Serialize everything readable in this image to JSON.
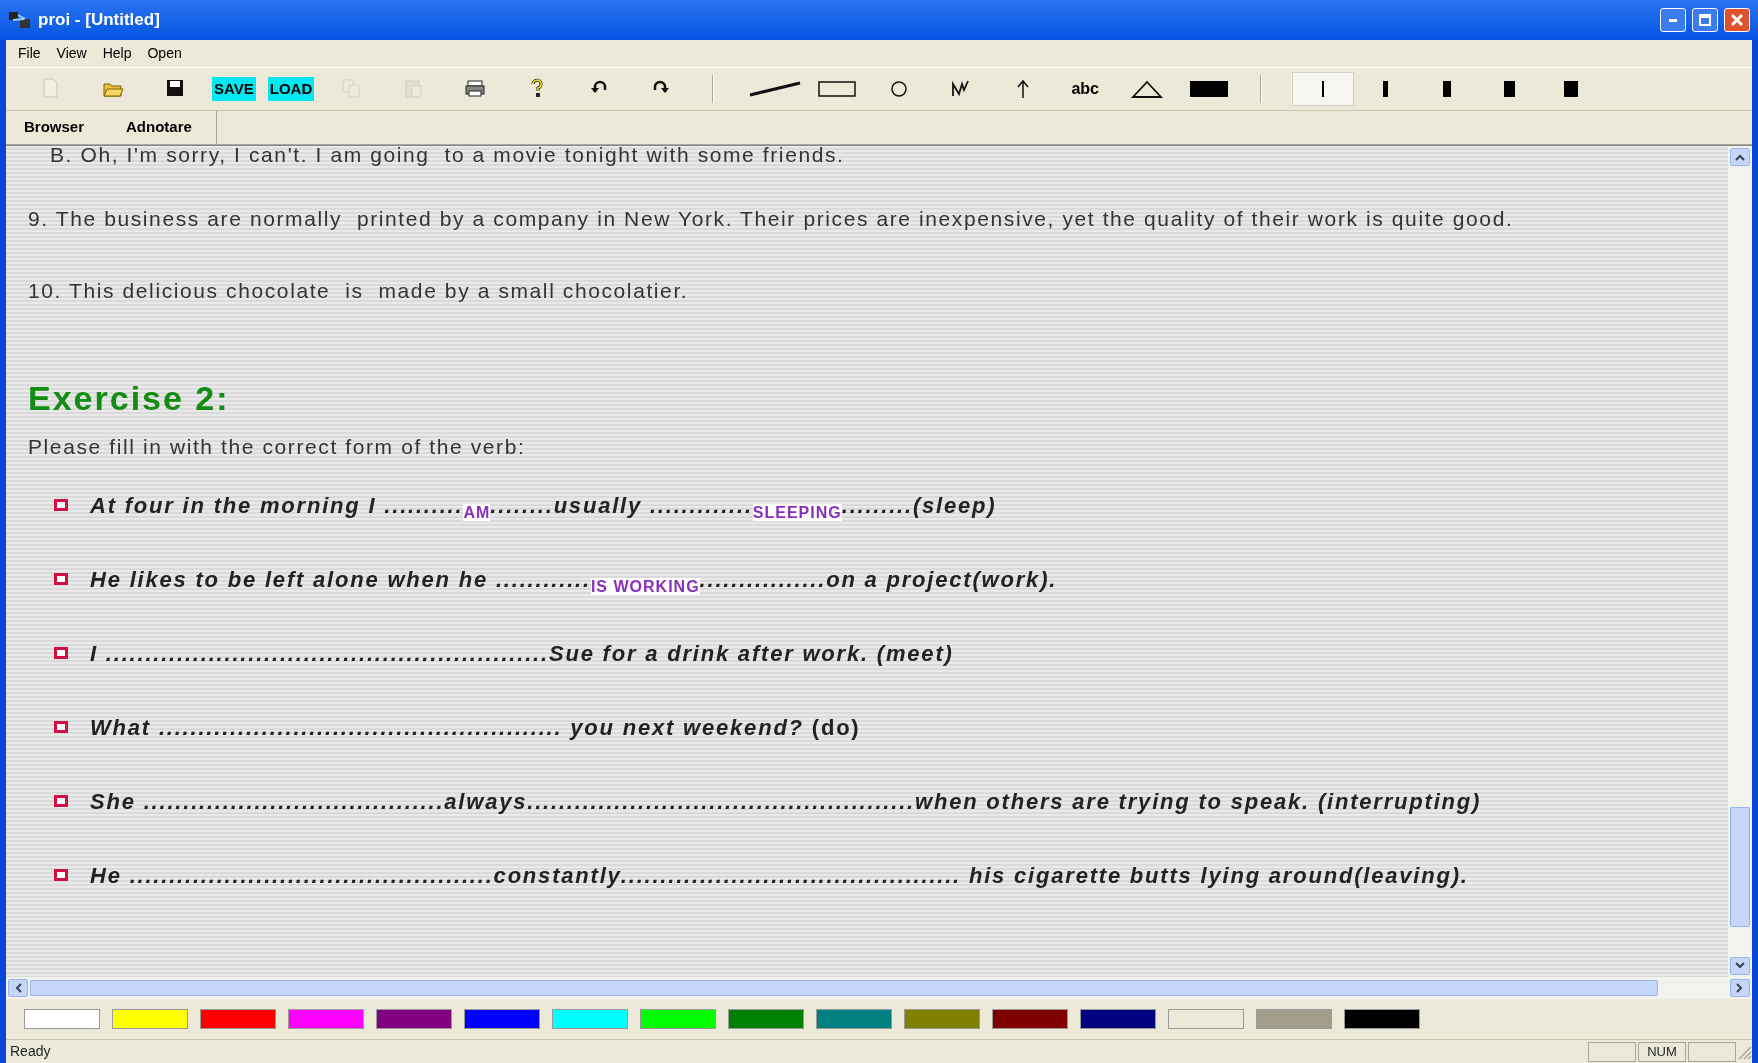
{
  "window": {
    "title": "proi - [Untitled]"
  },
  "menu": [
    "File",
    "View",
    "Help",
    "Open"
  ],
  "toolbar": [
    {
      "kind": "new",
      "disabled": true
    },
    {
      "kind": "open",
      "disabled": false
    },
    {
      "kind": "save",
      "disabled": false
    },
    {
      "kind": "label",
      "text": "SAVE"
    },
    {
      "kind": "label",
      "text": "LOAD"
    },
    {
      "kind": "copy",
      "disabled": true
    },
    {
      "kind": "paste",
      "disabled": true
    },
    {
      "kind": "print",
      "disabled": false
    },
    {
      "kind": "help",
      "disabled": false
    },
    {
      "kind": "undo",
      "disabled": false
    },
    {
      "kind": "redo",
      "disabled": false
    },
    {
      "kind": "sep"
    },
    {
      "kind": "line"
    },
    {
      "kind": "rect"
    },
    {
      "kind": "circle"
    },
    {
      "kind": "freehand"
    },
    {
      "kind": "arrow"
    },
    {
      "kind": "text",
      "text": "abc"
    },
    {
      "kind": "triangle"
    },
    {
      "kind": "fill"
    },
    {
      "kind": "sep"
    },
    {
      "kind": "width",
      "selected": true
    },
    {
      "kind": "width",
      "selected": false
    },
    {
      "kind": "width",
      "selected": false
    },
    {
      "kind": "width",
      "selected": false
    },
    {
      "kind": "width",
      "selected": false
    }
  ],
  "tabs": [
    {
      "label": "Browser",
      "selected": false
    },
    {
      "label": "Adnotare",
      "selected": false
    }
  ],
  "document": {
    "paragraphs": [
      {
        "kind": "cut",
        "text": "B. Oh, I'm sorry, I can't. I am going  to a movie tonight with some friends."
      },
      {
        "kind": "text",
        "text": "9. The business are normally  printed by a company in New York. Their prices are inexpensive, yet the quality of their work is quite good."
      },
      {
        "kind": "text",
        "text": "10. This delicious chocolate  is  made by a small chocolatier."
      }
    ],
    "heading": "Exercise 2:",
    "instruction": "Please fill in with the correct form of the verb:",
    "items": [
      [
        {
          "kind": "text",
          "text": "At four in the morning I .........."
        },
        {
          "kind": "answer",
          "text": "AM"
        },
        {
          "kind": "text",
          "text": "........usually ............."
        },
        {
          "kind": "answer",
          "text": "SLEEPING"
        },
        {
          "kind": "text",
          "text": ".........(sleep)"
        }
      ],
      [
        {
          "kind": "text",
          "text": "He likes to be left alone when he ............"
        },
        {
          "kind": "answer",
          "text": "IS WORKING"
        },
        {
          "kind": "text",
          "text": "................on a project(work)."
        }
      ],
      [
        {
          "kind": "text",
          "text": "I ........................................................Sue for a drink after work. (meet)"
        }
      ],
      [
        {
          "kind": "text",
          "text": "What ................................................... you next weekend?"
        },
        {
          "kind": "plain",
          "text": " (do)"
        }
      ],
      [
        {
          "kind": "text",
          "text": "She ......................................always.................................................when others are trying to speak. (interrupting)"
        }
      ],
      [
        {
          "kind": "text",
          "text": "He ..............................................constantly........................................... his cigarette butts lying around(leaving)."
        }
      ]
    ]
  },
  "palette": [
    {
      "color": "#ffffff"
    },
    {
      "color": "#ffff00"
    },
    {
      "color": "#ff0000"
    },
    {
      "color": "#ff00ff"
    },
    {
      "color": "#800080"
    },
    {
      "color": "#0000ff"
    },
    {
      "color": "#00ffff"
    },
    {
      "color": "#00ff00"
    },
    {
      "color": "#008000"
    },
    {
      "color": "#008080"
    },
    {
      "color": "#808000"
    },
    {
      "color": "#800000"
    },
    {
      "color": "#000080"
    },
    {
      "color": "#ece9d8"
    },
    {
      "color": "#a39e8c"
    },
    {
      "color": "#000000"
    }
  ],
  "status_bar": {
    "message": "Ready",
    "indicators": [
      "NUM"
    ]
  }
}
